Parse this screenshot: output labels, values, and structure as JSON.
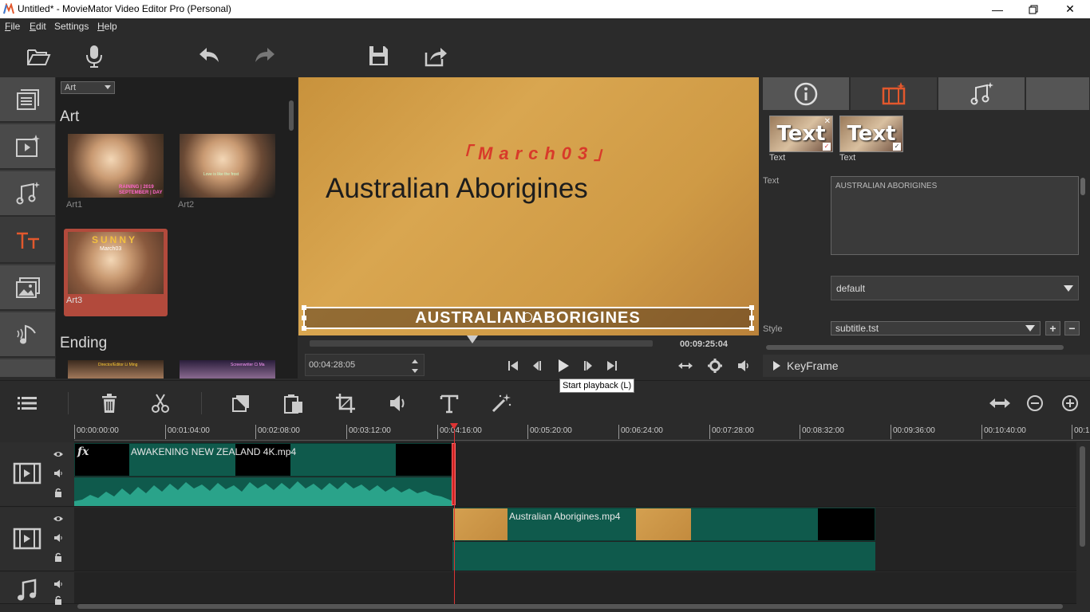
{
  "window": {
    "title": "Untitled* - MovieMator Video Editor Pro (Personal)"
  },
  "menu": [
    {
      "label": "File",
      "u": "F",
      "rest": "ile"
    },
    {
      "label": "Edit",
      "u": "E",
      "rest": "dit"
    },
    {
      "label": "Settings",
      "u": "",
      "rest": "Settings"
    },
    {
      "label": "Help",
      "u": "H",
      "rest": "elp"
    }
  ],
  "library": {
    "category_select": "Art",
    "sections": [
      {
        "title": "Art",
        "items": [
          {
            "label": "Art1",
            "caption": "RAINING | 2019 SEPTEMBER | DAY"
          },
          {
            "label": "Art2",
            "caption": "Love is like the frost"
          },
          {
            "label": "Art3",
            "caption": "SUNNY",
            "caption2": "March03",
            "selected": true
          }
        ]
      },
      {
        "title": "Ending",
        "items": [
          {
            "label": "",
            "caption": "Director/Editor Li Ming"
          },
          {
            "label": "",
            "caption": "Screenwriter Ci Ma"
          }
        ]
      }
    ]
  },
  "preview": {
    "text_top": "「March03」",
    "text_main": "Australian Aborigines",
    "subtitle": "AUSTRALIAN ABORIGINES"
  },
  "player": {
    "total_time": "00:09:25:04",
    "current_time": "00:04:28:05",
    "progress": 0.475
  },
  "tooltip": "Start playback (L)",
  "properties": {
    "filters": [
      {
        "label": "Text",
        "thumb_text": "Text"
      },
      {
        "label": "Text",
        "thumb_text": "Text"
      }
    ],
    "text_label": "Text",
    "text_value": "AUSTRALIAN ABORIGINES",
    "preset_value": "default",
    "style_label": "Style",
    "style_value": "subtitle.tst",
    "keyframe_label": "KeyFrame"
  },
  "timeline": {
    "ruler": [
      "00:00:00:00",
      "00:01:04:00",
      "00:02:08:00",
      "00:03:12:00",
      "00:04:16:00",
      "00:05:20:00",
      "00:06:24:00",
      "00:07:28:00",
      "00:08:32:00",
      "00:09:36:00",
      "00:10:40:00",
      "00:1"
    ],
    "track1_clip": "AWAKENING   NEW ZEALAND 4K.mp4",
    "track1_fx": "fx",
    "track2_clip": "Australian Aborigines.mp4"
  },
  "colors": {
    "accent": "#e2582d",
    "clip": "#0f5a4c",
    "playhead": "#d33333"
  }
}
